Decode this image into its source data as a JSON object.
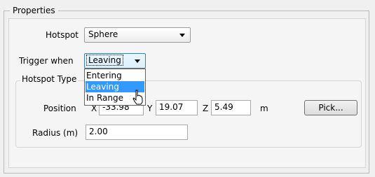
{
  "properties": {
    "title": "Properties",
    "hotspot": {
      "label": "Hotspot",
      "value": "Sphere"
    },
    "trigger": {
      "label": "Trigger when",
      "value": "Leaving",
      "options": [
        "Entering",
        "Leaving",
        "In Range"
      ]
    },
    "hotspot_type": {
      "title": "Hotspot Type",
      "position": {
        "label": "Position",
        "x_label": "X",
        "x_value": "-33.98",
        "y_label": "Y",
        "y_value": "19.07",
        "z_label": "Z",
        "z_value": "5.49",
        "unit": "m"
      },
      "pick_button": "Pick...",
      "radius": {
        "label": "Radius (m)",
        "value": "2.00"
      }
    }
  }
}
